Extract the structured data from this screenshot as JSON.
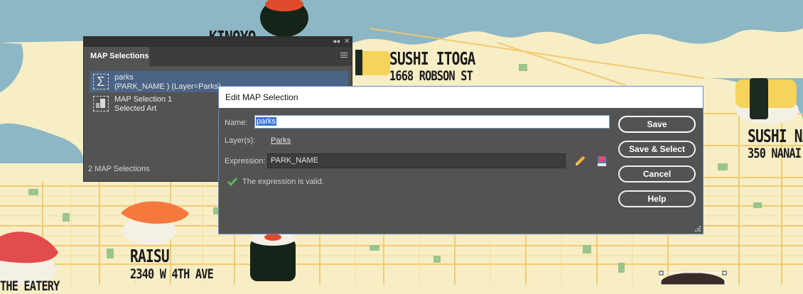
{
  "map": {
    "labels": {
      "kinoyo": "KINOYO",
      "sushi_itoga_name": "SUSHI ITOGA",
      "sushi_itoga_addr": "1668 ROBSON ST",
      "sushi_na_name": "SUSHI NA",
      "sushi_na_addr": "350 NANAI",
      "raisu_name": "RAISU",
      "raisu_addr": "2340 W 4TH AVE",
      "the_eatery": "THE EATERY"
    }
  },
  "panel": {
    "title": "MAP Selections",
    "items": [
      {
        "line1": "parks",
        "line2": "(PARK_NAME ) (Layer=Parks)",
        "icon": "sigma-icon",
        "selected": true
      },
      {
        "line1": "MAP Selection 1",
        "line2": "Selected Art",
        "icon": "art-selection-icon",
        "selected": false
      }
    ],
    "footer": "2 MAP Selections"
  },
  "dialog": {
    "title": "Edit MAP Selection",
    "name_label": "Name:",
    "name_value": "parks",
    "layers_label": "Layer(s):",
    "layers_value": "Parks",
    "expression_label": "Expression:",
    "expression_value": "PARK_NAME",
    "validation_message": "The expression is valid.",
    "buttons": {
      "save": "Save",
      "save_select": "Save & Select",
      "cancel": "Cancel",
      "help": "Help"
    }
  },
  "colors": {
    "panel_bg": "#535353",
    "selection_row": "#4b6384",
    "water": "#8db7c4",
    "land": "#f7eec6",
    "park": "#9bc58a",
    "road": "#f2c766",
    "valid_check": "#5cb85c"
  }
}
